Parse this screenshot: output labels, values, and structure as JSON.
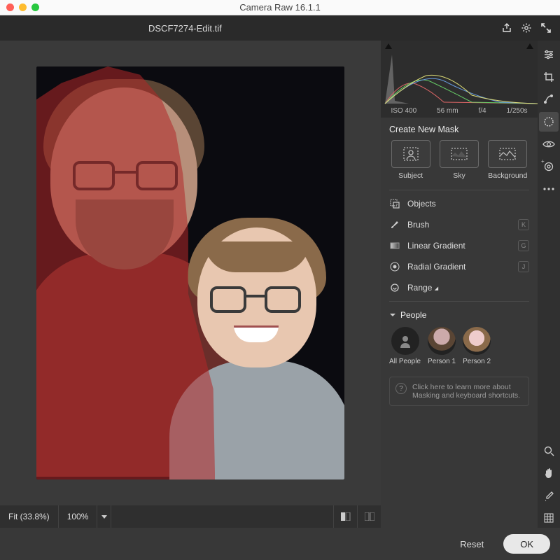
{
  "window": {
    "title": "Camera Raw 16.1.1"
  },
  "header": {
    "filename": "DSCF7274-Edit.tif"
  },
  "meta": {
    "iso": "ISO 400",
    "focal": "56 mm",
    "aperture": "f/4",
    "shutter": "1/250s"
  },
  "mask_panel": {
    "title": "Create New Mask",
    "buttons": [
      {
        "label": "Subject"
      },
      {
        "label": "Sky"
      },
      {
        "label": "Background"
      }
    ],
    "tools": [
      {
        "label": "Objects",
        "key": ""
      },
      {
        "label": "Brush",
        "key": "K"
      },
      {
        "label": "Linear Gradient",
        "key": "G"
      },
      {
        "label": "Radial Gradient",
        "key": "J"
      },
      {
        "label": "Range",
        "key": "",
        "submenu": true
      }
    ],
    "people_header": "People",
    "people": [
      {
        "label": "All People"
      },
      {
        "label": "Person 1"
      },
      {
        "label": "Person 2"
      }
    ],
    "hint": "Click here to learn more about Masking and keyboard shortcuts."
  },
  "zoom": {
    "fit": "Fit (33.8%)",
    "hundred": "100%"
  },
  "footer": {
    "reset": "Reset",
    "ok": "OK"
  }
}
